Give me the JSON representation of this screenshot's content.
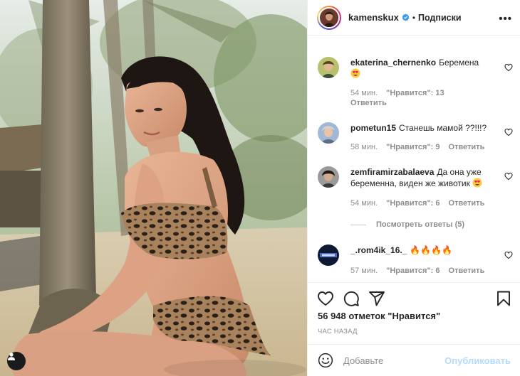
{
  "header": {
    "username": "kamenskux",
    "separator": "•",
    "follow_label": "Подписки",
    "more_label": "•••"
  },
  "comments": [
    {
      "username": "ekaterina_chernenko",
      "text": "Беремена",
      "time": "54 мин.",
      "likes": "\"Нравится\": 13",
      "reply": "Ответить"
    },
    {
      "username": "pometun15",
      "text": "Станешь мамой ??!!!?",
      "time": "58 мин.",
      "likes": "\"Нравится\": 9",
      "reply": "Ответить"
    },
    {
      "username": "zemfiramirzabalaeva",
      "text": "Да она уже беременна, виден же животик",
      "time": "54 мин.",
      "likes": "\"Нравится\": 6",
      "reply": "Ответить"
    },
    {
      "username": "_.rom4ik_16._",
      "text": "🔥🔥🔥🔥",
      "time": "57 мин.",
      "likes": "\"Нравится\": 6",
      "reply": "Ответить"
    }
  ],
  "view_replies": "Посмотреть ответы (5)",
  "likes_total": "56 948 отметок \"Нравится\"",
  "posted_ago": "ЧАС НАЗАД",
  "add_comment": {
    "placeholder": "Добавьте",
    "publish_label": "Опубликовать"
  },
  "icons": {
    "verified": "verified-badge-icon",
    "heart": "heart-icon",
    "comment": "comment-icon",
    "share": "share-icon",
    "save": "bookmark-icon",
    "emoji": "smiley-icon",
    "tag": "user-tag-icon"
  },
  "colors": {
    "text": "#262626",
    "muted": "#8e8e8e",
    "verified": "#3897f0",
    "publish_disabled": "#b3dbff",
    "border": "#efefef"
  }
}
